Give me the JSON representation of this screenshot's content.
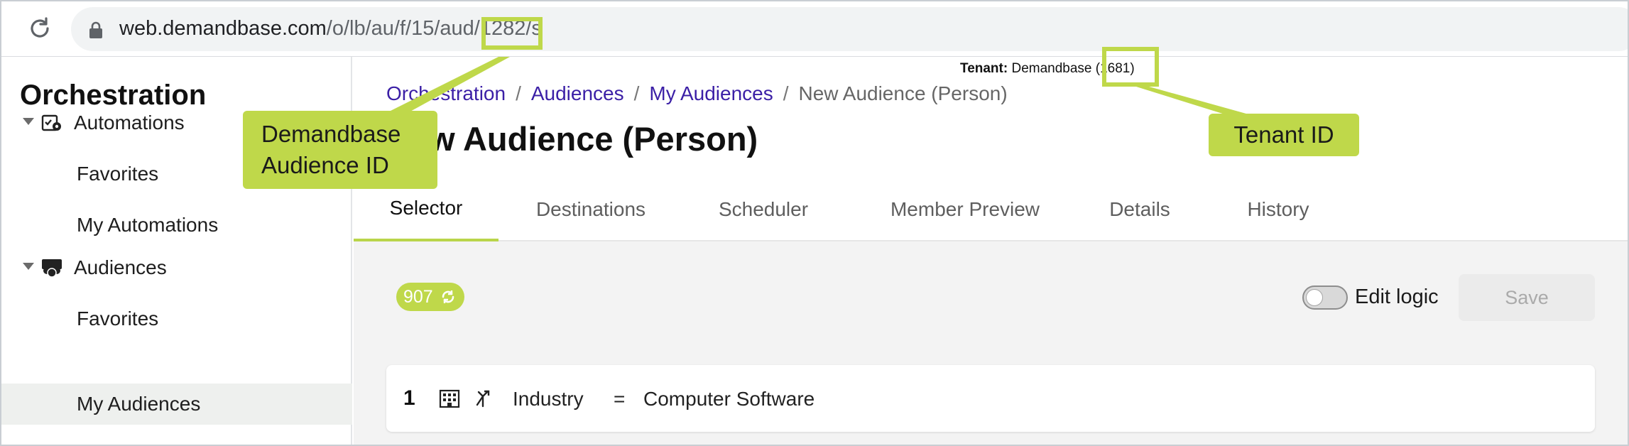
{
  "browser": {
    "url_host": "web.demandbase.com",
    "url_path": "/o/lb/au/f/15/aud/1282/s"
  },
  "sidebar": {
    "title": "Orchestration",
    "groups": [
      {
        "label": "Automations",
        "icon": "automation-gear-icon",
        "children": [
          "Favorites",
          "My Automations"
        ]
      },
      {
        "label": "Audiences",
        "icon": "audience-people-icon",
        "children": [
          "Favorites",
          "My Audiences"
        ]
      }
    ],
    "active_item": "My Audiences"
  },
  "header": {
    "tenant_label": "Tenant:",
    "tenant_value": "Demandbase (1681)",
    "breadcrumbs": [
      "Orchestration",
      "Audiences",
      "My Audiences",
      "New Audience (Person)"
    ],
    "title": "New Audience (Person)"
  },
  "tabs": [
    "Selector",
    "Destinations",
    "Scheduler",
    "Member Preview",
    "Details",
    "History"
  ],
  "active_tab": "Selector",
  "toolbar": {
    "member_count": "907",
    "edit_logic_label": "Edit logic",
    "edit_logic_on": false,
    "save_label": "Save"
  },
  "rules": [
    {
      "index": "1",
      "field": "Industry",
      "operator": "=",
      "value": "Computer Software"
    }
  ],
  "annotations": {
    "audience_id_callout": "Demandbase Audience ID",
    "audience_id_line1": "Demandbase",
    "audience_id_line2": "Audience ID",
    "tenant_id_callout": "Tenant ID"
  },
  "colors": {
    "accent_green": "#bfd84a",
    "link_purple": "#3b1fa6"
  }
}
